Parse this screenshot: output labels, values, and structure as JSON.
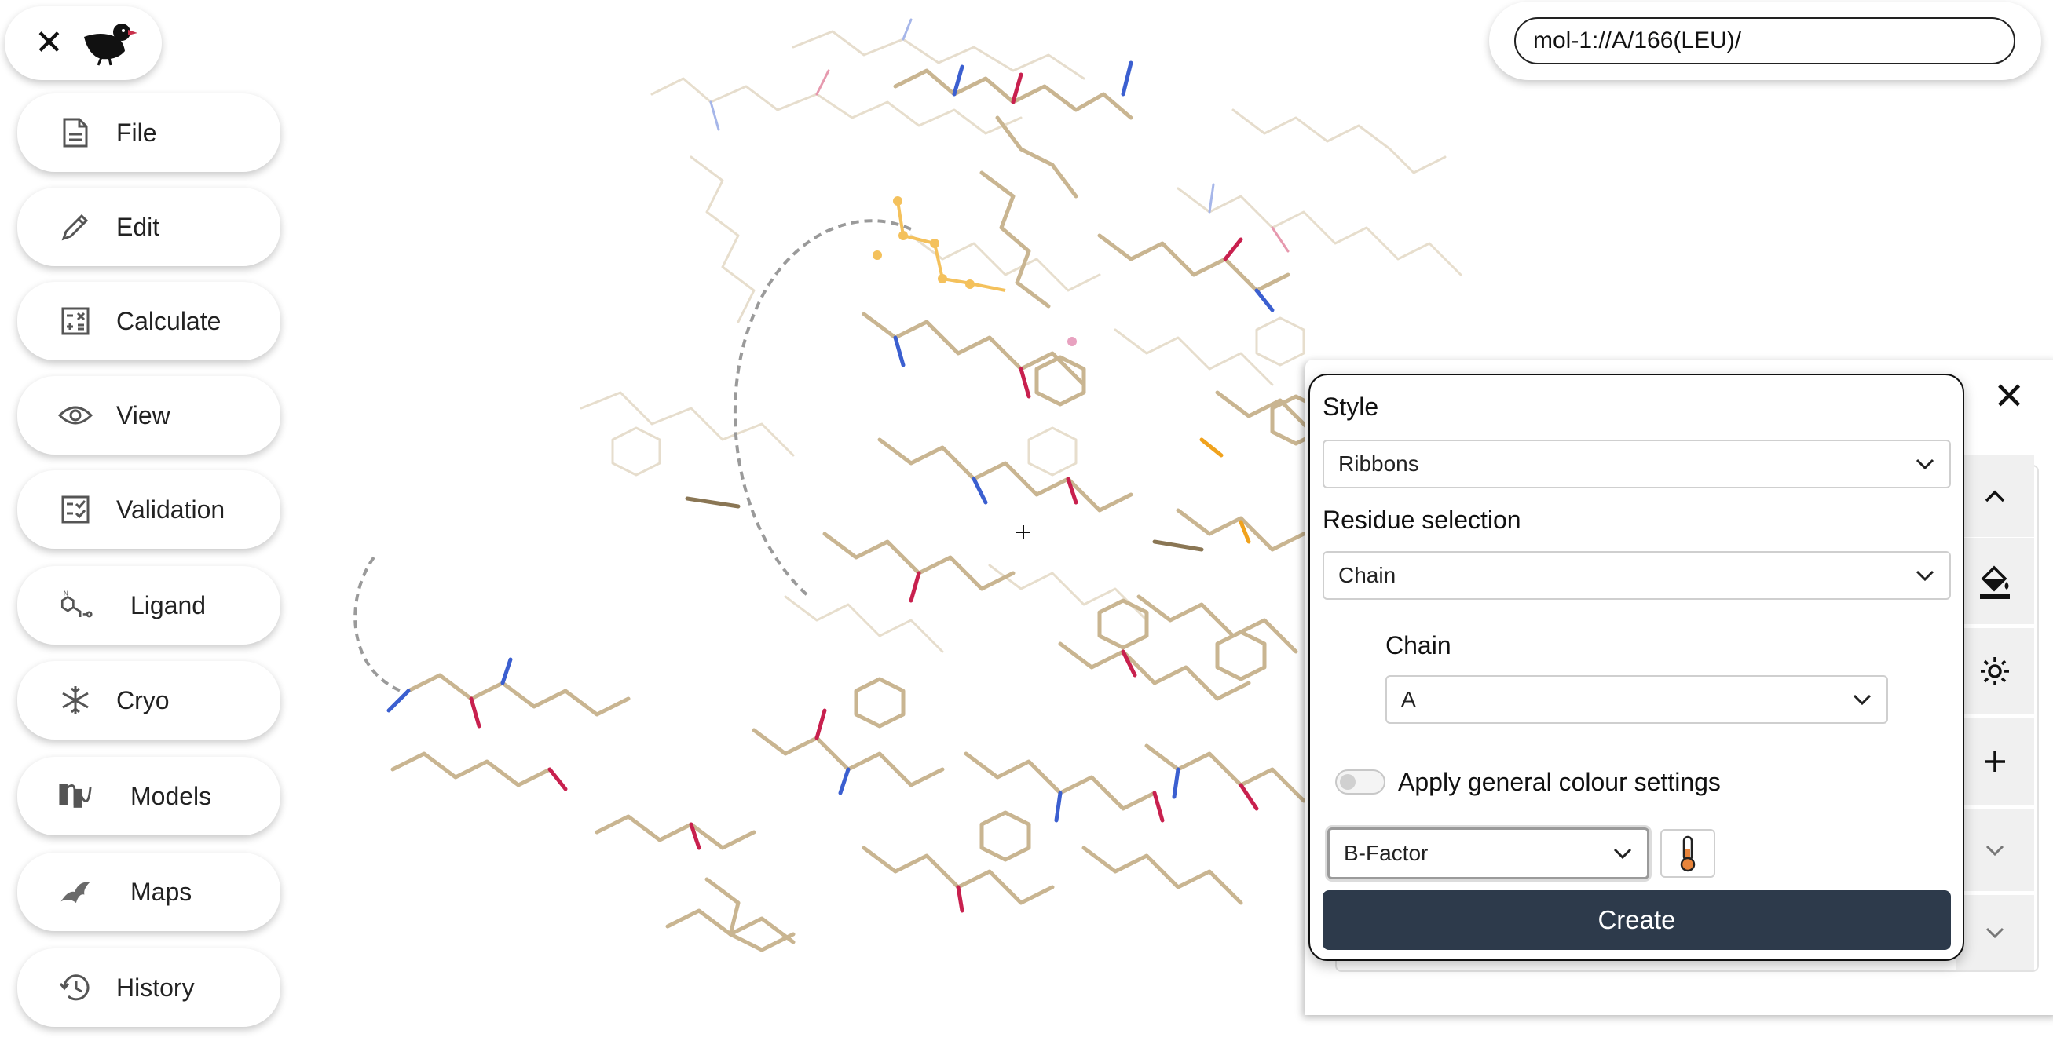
{
  "menu": {
    "items": [
      {
        "label": "File",
        "icon": "file-icon"
      },
      {
        "label": "Edit",
        "icon": "pencil-icon"
      },
      {
        "label": "Calculate",
        "icon": "calculator-icon"
      },
      {
        "label": "View",
        "icon": "eye-icon"
      },
      {
        "label": "Validation",
        "icon": "checklist-icon"
      },
      {
        "label": "Ligand",
        "icon": "ligand-icon"
      },
      {
        "label": "Cryo",
        "icon": "snowflake-icon"
      },
      {
        "label": "Models",
        "icon": "models-icon"
      },
      {
        "label": "Maps",
        "icon": "maps-icon"
      },
      {
        "label": "History",
        "icon": "history-icon"
      }
    ]
  },
  "address": {
    "value": "mol-1://A/166(LEU)/"
  },
  "dialog": {
    "style_label": "Style",
    "style_value": "Ribbons",
    "residue_label": "Residue selection",
    "residue_value": "Chain",
    "chain_label": "Chain",
    "chain_value": "A",
    "apply_label": "Apply general colour settings",
    "colour_mode_value": "B-Factor",
    "create_label": "Create"
  },
  "side_panel": {
    "icons": [
      "close-icon",
      "chevron-up-icon",
      "paint-bucket-icon",
      "gear-icon",
      "plus-icon",
      "chevron-down-icon",
      "chevron-down-icon"
    ]
  },
  "colors": {
    "carbon": "#c9b591",
    "nitrogen": "#3b5fd0",
    "oxygen": "#c8204e",
    "sulfur": "#f0a21d",
    "create_button": "#2d3a4b"
  }
}
